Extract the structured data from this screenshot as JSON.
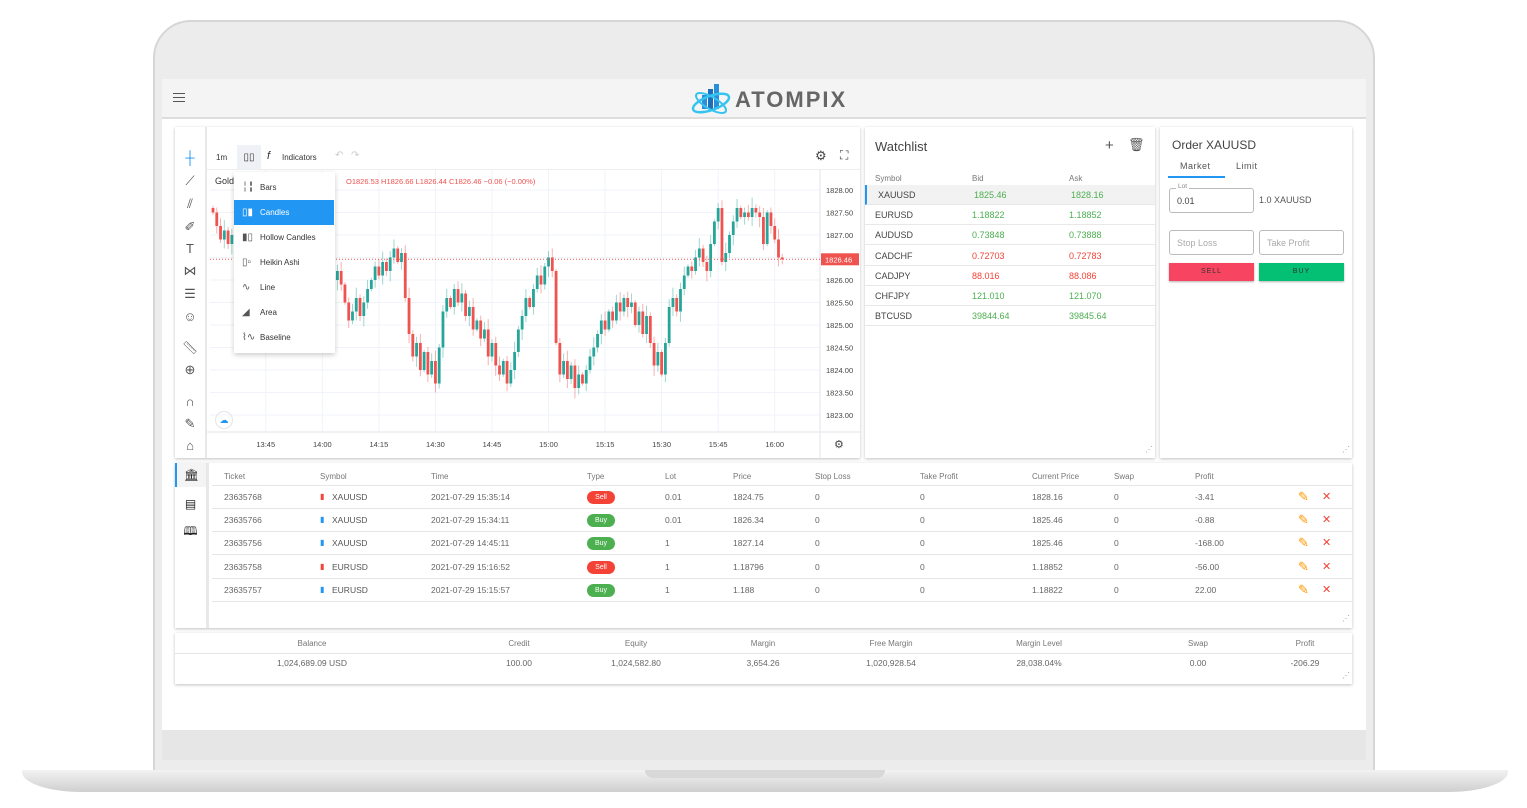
{
  "header": {
    "brand": "ATOMPIX",
    "menu_icon": "hamburger-icon"
  },
  "chart": {
    "toolbar": {
      "interval": "1m",
      "indicators": "Indicators"
    },
    "symbol_label": "Gold",
    "ohlc_text": "O1826.53 H1826.66 L1826.44 C1826.46 −0.06 (−0.00%)",
    "chart_type_menu": [
      {
        "label": "Bars",
        "icon": "bars-icon",
        "selected": false
      },
      {
        "label": "Candles",
        "icon": "candles-icon",
        "selected": true
      },
      {
        "label": "Hollow Candles",
        "icon": "hollow-candles-icon",
        "selected": false
      },
      {
        "label": "Heikin Ashi",
        "icon": "heikin-ashi-icon",
        "selected": false
      },
      {
        "label": "Line",
        "icon": "line-icon",
        "selected": false
      },
      {
        "label": "Area",
        "icon": "area-icon",
        "selected": false
      },
      {
        "label": "Baseline",
        "icon": "baseline-icon",
        "selected": false
      }
    ],
    "colors": {
      "up": "#26a69a",
      "down": "#ef5350",
      "selection": "#2196f3"
    }
  },
  "chart_data": {
    "type": "candlestick",
    "interval": "1m",
    "start_time": "13:31",
    "x_ticks": [
      "13:45",
      "14:00",
      "14:15",
      "14:30",
      "14:45",
      "15:00",
      "15:15",
      "15:30",
      "15:45",
      "16:00"
    ],
    "y_ticks": [
      "1828.00",
      "1827.50",
      "1827.00",
      "1826.50",
      "1826.00",
      "1825.50",
      "1825.00",
      "1824.50",
      "1824.00",
      "1823.50",
      "1823.00"
    ],
    "ylim": [
      1822.65,
      1829.0
    ],
    "last_price": "1826.46",
    "closes": [
      1827.5,
      1827.2,
      1826.9,
      1827.1,
      1826.8,
      1827.0,
      1826.7,
      1826.9,
      1826.5,
      1826.6,
      1826.3,
      1826.5,
      1826.2,
      1826.4,
      1826.1,
      1826.3,
      1826.0,
      1826.2,
      1825.9,
      1826.1,
      1825.8,
      1825.9,
      1825.6,
      1825.8,
      1826.0,
      1825.7,
      1825.9,
      1826.1,
      1825.8,
      1826.0,
      1825.9,
      1826.1,
      1826.0,
      1826.2,
      1825.9,
      1825.5,
      1825.1,
      1825.3,
      1825.6,
      1825.2,
      1825.5,
      1825.8,
      1826.0,
      1826.3,
      1826.1,
      1826.4,
      1826.2,
      1826.5,
      1826.7,
      1826.4,
      1826.6,
      1825.6,
      1824.8,
      1824.3,
      1824.6,
      1824.0,
      1824.4,
      1823.9,
      1824.2,
      1823.7,
      1824.5,
      1825.3,
      1825.6,
      1825.4,
      1825.8,
      1825.5,
      1825.7,
      1825.2,
      1825.4,
      1824.9,
      1825.1,
      1824.7,
      1824.9,
      1824.3,
      1824.6,
      1824.1,
      1823.9,
      1824.2,
      1823.7,
      1824.0,
      1824.4,
      1824.9,
      1825.2,
      1825.6,
      1825.4,
      1825.8,
      1826.1,
      1825.9,
      1826.3,
      1826.5,
      1826.2,
      1824.6,
      1823.9,
      1824.2,
      1823.8,
      1824.1,
      1823.6,
      1823.9,
      1823.7,
      1824.0,
      1824.3,
      1824.5,
      1824.8,
      1825.1,
      1824.9,
      1825.3,
      1825.1,
      1825.5,
      1825.3,
      1825.6,
      1825.4,
      1825.5,
      1825.0,
      1825.3,
      1824.8,
      1825.2,
      1824.6,
      1824.1,
      1824.4,
      1823.9,
      1824.6,
      1825.4,
      1825.6,
      1825.3,
      1825.8,
      1826.1,
      1826.3,
      1826.2,
      1826.5,
      1826.7,
      1826.4,
      1826.2,
      1826.8,
      1827.3,
      1827.6,
      1826.4,
      1826.6,
      1827.0,
      1827.3,
      1827.6,
      1827.4,
      1827.5,
      1827.4,
      1827.6,
      1827.5,
      1827.4,
      1826.8,
      1827.5,
      1827.2,
      1826.9,
      1826.5,
      1826.46
    ]
  },
  "watchlist": {
    "title": "Watchlist",
    "columns": [
      "Symbol",
      "Bid",
      "Ask"
    ],
    "rows": [
      {
        "symbol": "XAUUSD",
        "bid": "1825.46",
        "ask": "1828.16",
        "dir": "up",
        "selected": true
      },
      {
        "symbol": "EURUSD",
        "bid": "1.18822",
        "ask": "1.18852",
        "dir": "up"
      },
      {
        "symbol": "AUDUSD",
        "bid": "0.73848",
        "ask": "0.73888",
        "dir": "up"
      },
      {
        "symbol": "CADCHF",
        "bid": "0.72703",
        "ask": "0.72783",
        "dir": "down"
      },
      {
        "symbol": "CADJPY",
        "bid": "88.016",
        "ask": "88.086",
        "dir": "down"
      },
      {
        "symbol": "CHFJPY",
        "bid": "121.010",
        "ask": "121.070",
        "dir": "up"
      },
      {
        "symbol": "BTCUSD",
        "bid": "39844.64",
        "ask": "39845.64",
        "dir": "up"
      }
    ]
  },
  "order": {
    "title": "Order XAUUSD",
    "tabs": [
      "Market",
      "Limit"
    ],
    "lot_label": "Lot",
    "lot_value": "0.01",
    "lot_info": "1.0 XAUUSD",
    "stop_loss_placeholder": "Stop Loss",
    "take_profit_placeholder": "Take Profit",
    "sell": "SELL",
    "buy": "BUY",
    "colors": {
      "sell": "#f74561",
      "buy": "#03c074"
    }
  },
  "positions": {
    "columns": [
      "Ticket",
      "Symbol",
      "Time",
      "Type",
      "Lot",
      "Price",
      "Stop Loss",
      "Take Profit",
      "Current Price",
      "Swap",
      "Profit"
    ],
    "rows": [
      {
        "ticket": "23635768",
        "symbol": "XAUUSD",
        "time": "2021-07-29 15:35:14",
        "type": "Sell",
        "lot": "0.01",
        "price": "1824.75",
        "sl": "0",
        "tp": "0",
        "current": "1828.16",
        "swap": "0",
        "profit": "-3.41"
      },
      {
        "ticket": "23635766",
        "symbol": "XAUUSD",
        "time": "2021-07-29 15:34:11",
        "type": "Buy",
        "lot": "0.01",
        "price": "1826.34",
        "sl": "0",
        "tp": "0",
        "current": "1825.46",
        "swap": "0",
        "profit": "-0.88"
      },
      {
        "ticket": "23635756",
        "symbol": "XAUUSD",
        "time": "2021-07-29 14:45:11",
        "type": "Buy",
        "lot": "1",
        "price": "1827.14",
        "sl": "0",
        "tp": "0",
        "current": "1825.46",
        "swap": "0",
        "profit": "-168.00"
      },
      {
        "ticket": "23635758",
        "symbol": "EURUSD",
        "time": "2021-07-29 15:16:52",
        "type": "Sell",
        "lot": "1",
        "price": "1.18796",
        "sl": "0",
        "tp": "0",
        "current": "1.18852",
        "swap": "0",
        "profit": "-56.00"
      },
      {
        "ticket": "23635757",
        "symbol": "EURUSD",
        "time": "2021-07-29 15:15:57",
        "type": "Buy",
        "lot": "1",
        "price": "1.188",
        "sl": "0",
        "tp": "0",
        "current": "1.18822",
        "swap": "0",
        "profit": "22.00"
      }
    ]
  },
  "account": {
    "columns": [
      "Balance",
      "Credit",
      "Equity",
      "Margin",
      "Free Margin",
      "Margin Level",
      "Swap",
      "Profit"
    ],
    "values": [
      "1,024,689.09 USD",
      "100.00",
      "1,024,582.80",
      "3,654.26",
      "1,020,928.54",
      "28,038.04%",
      "0.00",
      "-206.29"
    ]
  }
}
